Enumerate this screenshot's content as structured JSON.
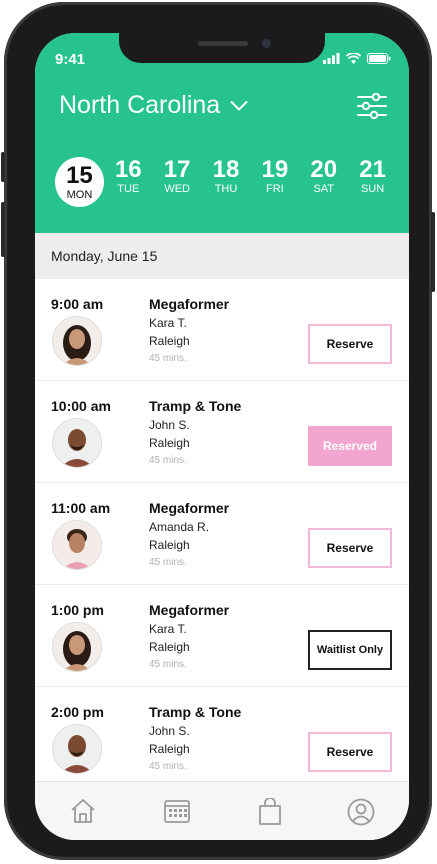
{
  "status_bar": {
    "time": "9:41"
  },
  "header": {
    "location": "North Carolina"
  },
  "week": [
    {
      "num": "15",
      "dow": "MON",
      "selected": true
    },
    {
      "num": "16",
      "dow": "TUE"
    },
    {
      "num": "17",
      "dow": "WED"
    },
    {
      "num": "18",
      "dow": "THU"
    },
    {
      "num": "19",
      "dow": "FRI"
    },
    {
      "num": "20",
      "dow": "SAT"
    },
    {
      "num": "21",
      "dow": "SUN"
    }
  ],
  "date_heading": "Monday, June 15",
  "classes": [
    {
      "time": "9:00 am",
      "name": "Megaformer",
      "instructor": "Kara T.",
      "location": "Raleigh",
      "duration": "45 mins.",
      "action": "Reserve",
      "state": "reserve"
    },
    {
      "time": "10:00 am",
      "name": "Tramp & Tone",
      "instructor": "John S.",
      "location": "Raleigh",
      "duration": "45 mins.",
      "action": "Reserved",
      "state": "reserved"
    },
    {
      "time": "11:00 am",
      "name": "Megaformer",
      "instructor": "Amanda R.",
      "location": "Raleigh",
      "duration": "45 mins.",
      "action": "Reserve",
      "state": "reserve"
    },
    {
      "time": "1:00 pm",
      "name": "Megaformer",
      "instructor": "Kara T.",
      "location": "Raleigh",
      "duration": "45 mins.",
      "action": "Waitlist Only",
      "state": "waitlist"
    },
    {
      "time": "2:00 pm",
      "name": "Tramp & Tone",
      "instructor": "John S.",
      "location": "Raleigh",
      "duration": "45 mins.",
      "action": "Reserve",
      "state": "reserve"
    }
  ],
  "tabs": [
    {
      "icon": "home-icon"
    },
    {
      "icon": "calendar-icon"
    },
    {
      "icon": "shopping-bag-icon"
    },
    {
      "icon": "profile-icon"
    }
  ],
  "colors": {
    "accent": "#26c48c",
    "reserved": "#f2a6cf",
    "reserve_border": "#f2b8d8"
  }
}
